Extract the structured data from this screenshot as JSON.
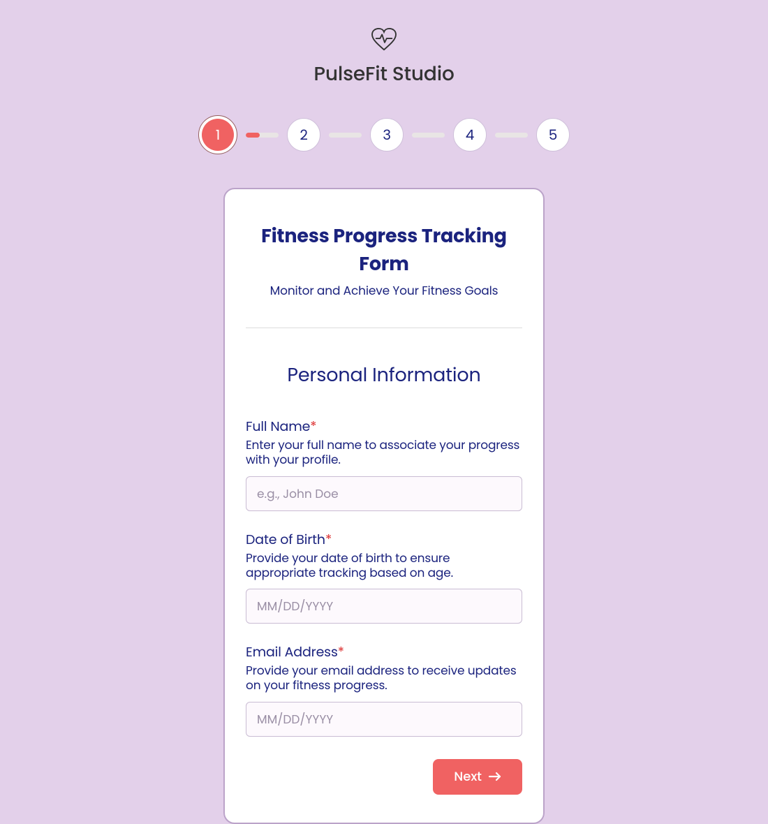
{
  "brand": {
    "name": "PulseFit Studio"
  },
  "stepper": {
    "steps": [
      "1",
      "2",
      "3",
      "4",
      "5"
    ],
    "current": 1
  },
  "form": {
    "title": "Fitness Progress Tracking Form",
    "subtitle": "Monitor and Achieve Your Fitness Goals",
    "section_title": "Personal Information",
    "fields": {
      "full_name": {
        "label": "Full Name",
        "description": "Enter your full name to associate your progress with your profile.",
        "placeholder": "e.g., John Doe"
      },
      "dob": {
        "label": "Date of Birth",
        "description": "Provide your date of birth to ensure appropriate tracking based on age.",
        "placeholder": "MM/DD/YYYY"
      },
      "email": {
        "label": "Email Address",
        "description": "Provide your email address to receive updates on your fitness progress.",
        "placeholder": "MM/DD/YYYY"
      }
    },
    "next_button": "Next"
  }
}
